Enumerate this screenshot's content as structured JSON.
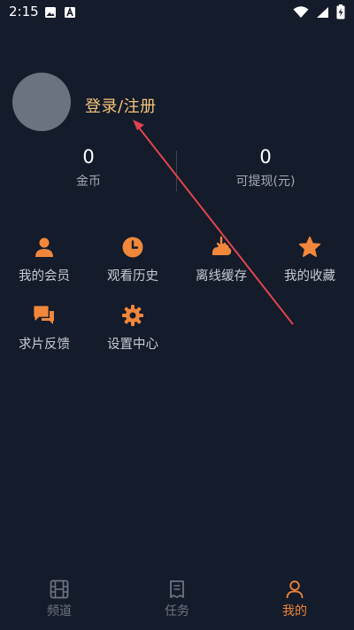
{
  "status_bar": {
    "time": "2:15"
  },
  "profile": {
    "login_label": "登录/注册"
  },
  "stats": [
    {
      "value": "0",
      "label": "金币"
    },
    {
      "value": "0",
      "label": "可提现(元)"
    }
  ],
  "menu": {
    "items": [
      {
        "label": "我的会员",
        "icon": "person-icon"
      },
      {
        "label": "观看历史",
        "icon": "clock-icon"
      },
      {
        "label": "离线缓存",
        "icon": "download-cloud-icon"
      },
      {
        "label": "我的收藏",
        "icon": "star-icon"
      },
      {
        "label": "求片反馈",
        "icon": "chat-bubbles-icon"
      },
      {
        "label": "设置中心",
        "icon": "gear-icon"
      }
    ]
  },
  "tabbar": {
    "tabs": [
      {
        "label": "频道",
        "icon": "film-icon",
        "active": false
      },
      {
        "label": "任务",
        "icon": "task-list-icon",
        "active": false
      },
      {
        "label": "我的",
        "icon": "user-icon",
        "active": true
      }
    ]
  },
  "colors": {
    "background": "#141b2a",
    "accent": "#f0873a",
    "login_text": "#f6c47a",
    "annotation_arrow": "#e0434f"
  }
}
